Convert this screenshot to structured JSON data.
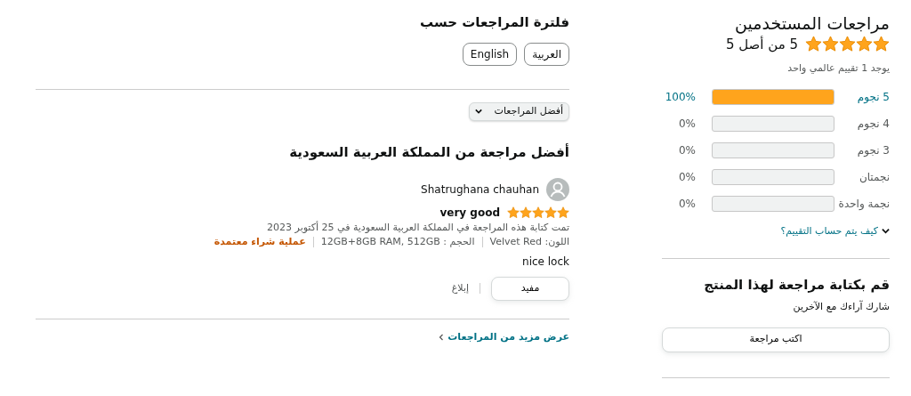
{
  "summary": {
    "title": "مراجعات المستخدمين",
    "stars": 5,
    "rating_text": "5 من أصل 5",
    "count_text": "يوجد 1 تقييم عالمي واحد",
    "histogram": [
      {
        "label": "5 نجوم",
        "level": 1,
        "percent": "100%",
        "linked": true
      },
      {
        "label": "4 نجوم",
        "level": 0,
        "percent": "0%",
        "linked": false
      },
      {
        "label": "3 نجوم",
        "level": 0,
        "percent": "0%",
        "linked": false
      },
      {
        "label": "نجمتان",
        "level": 0,
        "percent": "0%",
        "linked": false
      },
      {
        "label": "نجمة واحدة",
        "level": 0,
        "percent": "0%",
        "linked": false
      }
    ],
    "how_link": "كيف يتم حساب التقييم؟"
  },
  "write_review": {
    "title": "قم بكتابة مراجعة لهذا المنتج",
    "subtitle": "شارك آراءك مع الآخرين",
    "button": "اكتب مراجعة"
  },
  "filter": {
    "title": "فلترة المراجعات حسب",
    "languages": [
      "العربية",
      "English"
    ],
    "sort": "أفضل المراجعات"
  },
  "top_reviews": {
    "title": "أفضل مراجعة من المملكة العربية السعودية",
    "review": {
      "author": "Shatrughana chauhan",
      "stars": 5,
      "title": "very good",
      "date": "تمت كتابة هذه المراجعة في المملكة العربية السعودية في 25 أكتوبر 2023",
      "variant_color": "اللون: Velvet Red",
      "size": "الحجم : 12GB+8GB RAM, 512GB",
      "verified": "عملية شراء معتمدة",
      "body": "nice lock",
      "helpful": "مفيد",
      "report": "إبلاغ"
    },
    "more_link": "عرض مزيد من المراجعات"
  }
}
